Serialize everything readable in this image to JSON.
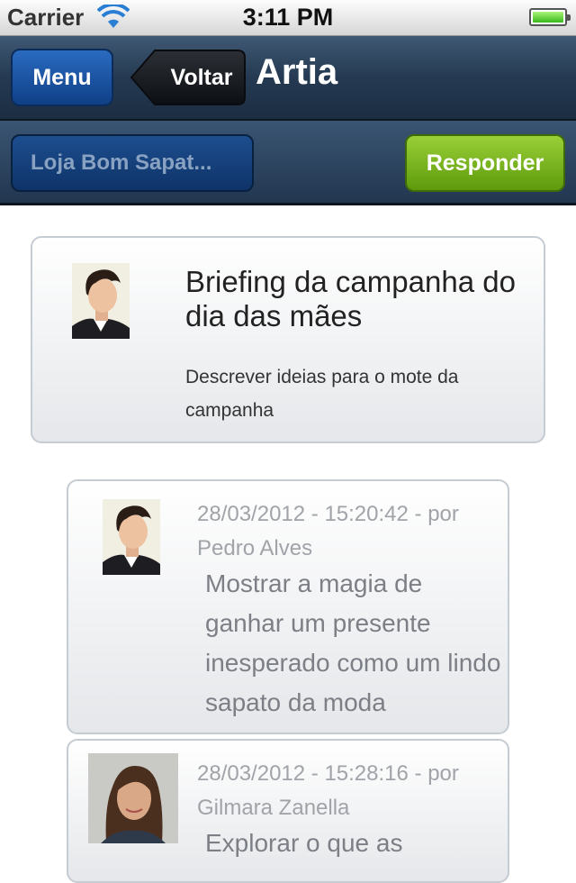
{
  "status_bar": {
    "carrier": "Carrier",
    "time": "3:11 PM",
    "wifi_icon": "wifi-icon",
    "battery_icon": "battery-icon",
    "battery_level": 1.0
  },
  "nav": {
    "menu_label": "Menu",
    "back_label": "Voltar",
    "title": "Artia"
  },
  "toolbar": {
    "project_label": "Loja Bom Sapat...",
    "reply_label": "Responder"
  },
  "task": {
    "title": "Briefing da campanha do dia das mães",
    "description": "Descrever ideias para o mote da campanha",
    "avatar_icon": "user-avatar-male"
  },
  "comments": [
    {
      "meta": "28/03/2012 - 15:20:42 - por Pedro Alves",
      "text": "Mostrar a magia de ganhar um presente inesperado como um lindo sapato da moda",
      "avatar_icon": "user-avatar-male"
    },
    {
      "meta": "28/03/2012 - 15:28:16 - por Gilmara Zanella",
      "text": "Explorar o que as",
      "avatar_icon": "user-avatar-female"
    }
  ],
  "colors": {
    "nav_dark": "#253a52",
    "menu_blue": "#1a56a8",
    "reply_green": "#7bb622",
    "meta_gray": "#a0a3a8"
  }
}
